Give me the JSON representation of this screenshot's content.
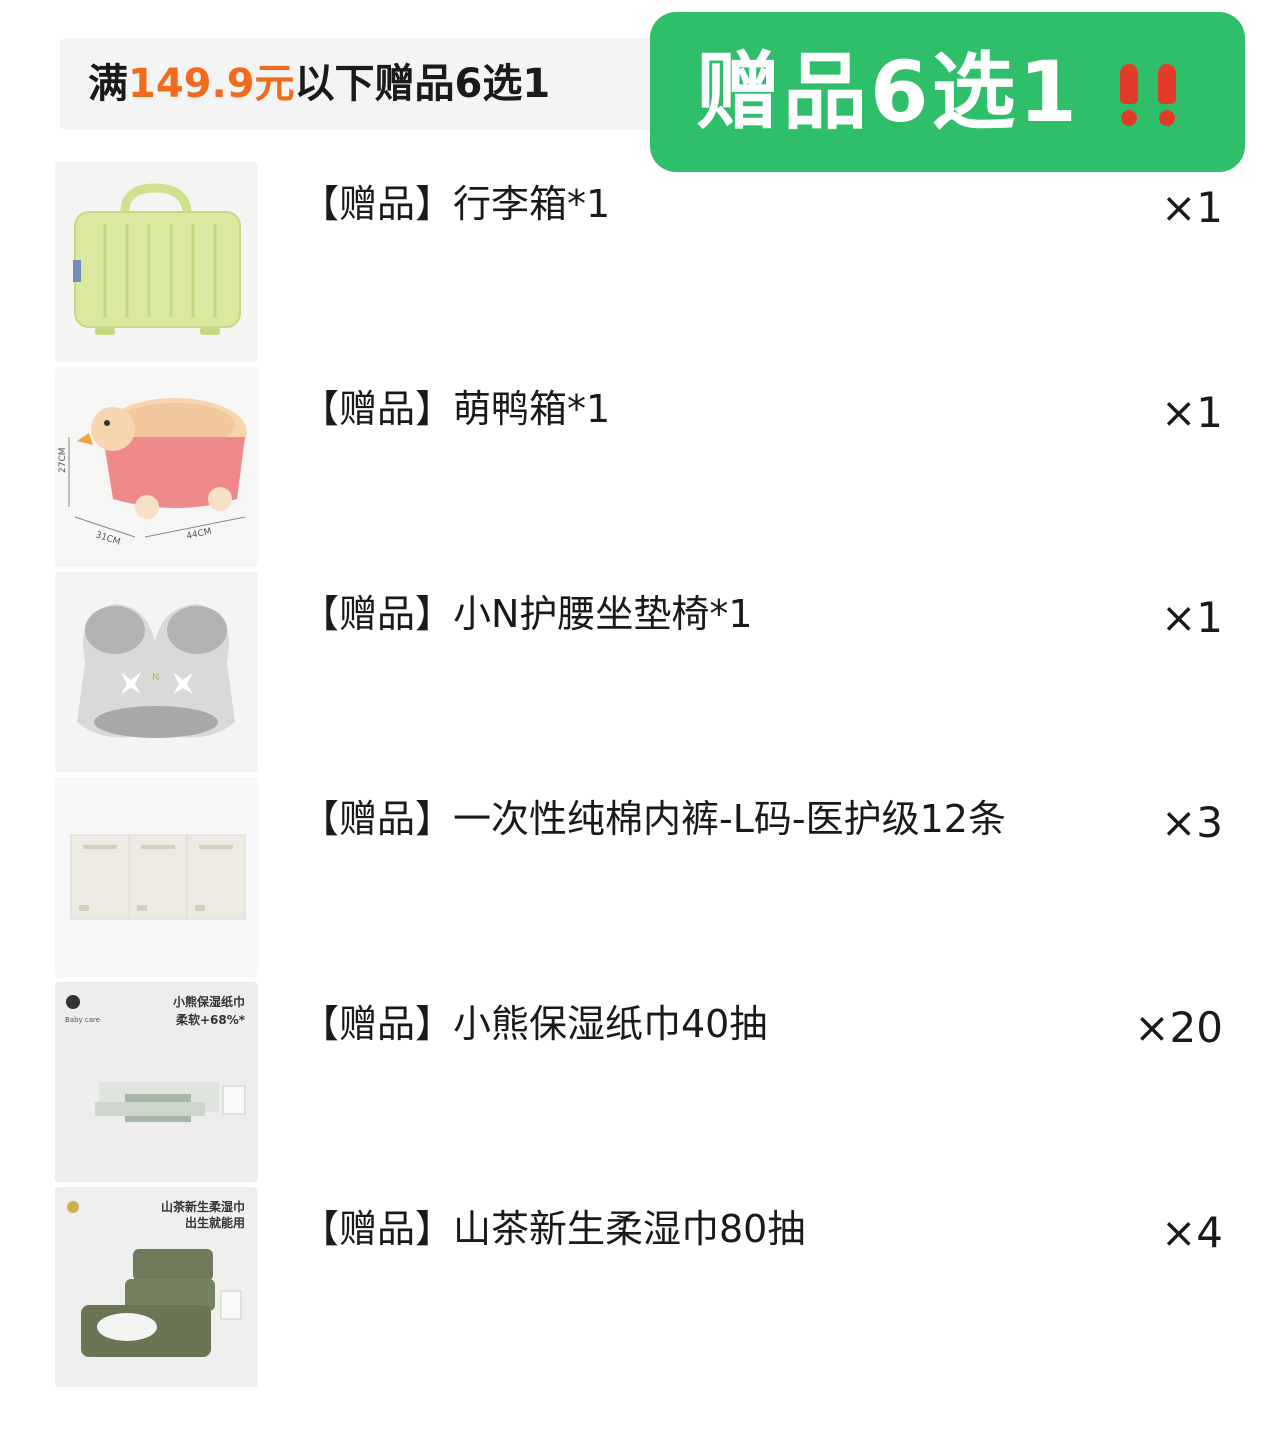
{
  "header": {
    "prefix": "满",
    "price": "149.9元",
    "suffix": "以下赠品6选1"
  },
  "badge": {
    "text": "赠品6选1",
    "icon": "double-exclamation-icon",
    "color": "#2fbf6b"
  },
  "colors": {
    "price": "#f26b1d",
    "exclamation": "#e33a2a"
  },
  "gifts": [
    {
      "name": "【赠品】行李箱*1",
      "qty": "×1",
      "icon": "suitcase-icon"
    },
    {
      "name": "【赠品】萌鸭箱*1",
      "qty": "×1",
      "icon": "duck-box-icon",
      "image_labels": {
        "height": "27CM",
        "depth": "31CM",
        "width": "44CM"
      }
    },
    {
      "name": "【赠品】小N护腰坐垫椅*1",
      "qty": "×1",
      "icon": "seat-cushion-icon"
    },
    {
      "name": "【赠品】一次性纯棉内裤-L码-医护级12条",
      "qty": "×3",
      "icon": "underwear-pack-icon"
    },
    {
      "name": "【赠品】小熊保湿纸巾40抽",
      "qty": "×20",
      "icon": "tissue-pack-icon",
      "image_labels": {
        "line1": "小熊保湿纸巾",
        "line2": "柔软+68%*",
        "brand": "Baby care"
      }
    },
    {
      "name": "【赠品】山茶新生柔湿巾80抽",
      "qty": "×4",
      "icon": "wet-wipes-icon",
      "image_labels": {
        "line1": "山茶新生柔湿巾",
        "line2": "出生就能用"
      }
    }
  ]
}
